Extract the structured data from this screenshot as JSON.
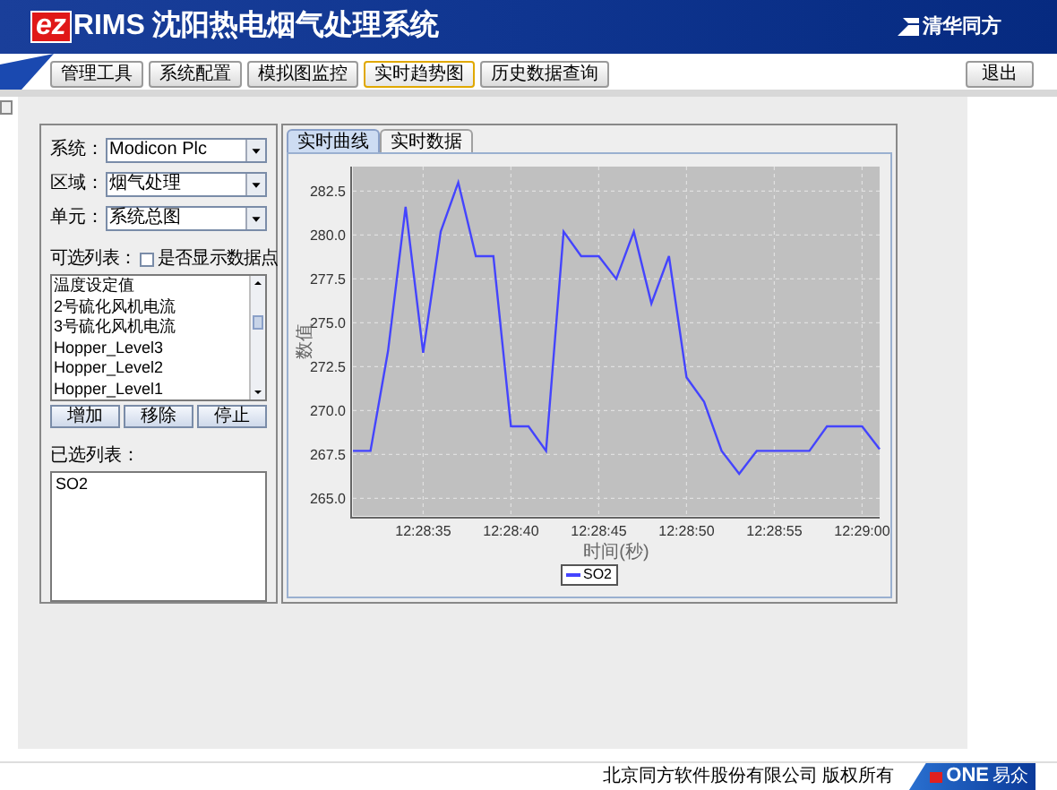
{
  "header": {
    "logo_ez": "ez",
    "logo_rims": "RIMS",
    "title": "沈阳热电烟气处理系统",
    "brand": "清华同方"
  },
  "nav": {
    "tabs": [
      {
        "label": "管理工具",
        "selected": false
      },
      {
        "label": "系统配置",
        "selected": false
      },
      {
        "label": "模拟图监控",
        "selected": false
      },
      {
        "label": "实时趋势图",
        "selected": true
      },
      {
        "label": "历史数据查询",
        "selected": false
      }
    ],
    "exit": "退出"
  },
  "filters": [
    {
      "label": "系统：",
      "value": "Modicon Plc"
    },
    {
      "label": "区域：",
      "value": "烟气处理"
    },
    {
      "label": "单元：",
      "value": "系统总图"
    }
  ],
  "available": {
    "label": "可选列表：",
    "show_points": {
      "label": "是否显示数据点",
      "checked": false
    },
    "items": [
      "温度设定值",
      "2号硫化风机电流",
      "3号硫化风机电流",
      "Hopper_Level3",
      "Hopper_Level2",
      "Hopper_Level1"
    ]
  },
  "buttons": [
    "增加",
    "移除",
    "停止"
  ],
  "selected_list": {
    "label": "已选列表：",
    "items": [
      "SO2"
    ]
  },
  "chart_tabs": [
    {
      "label": "实时曲线",
      "selected": true
    },
    {
      "label": "实时数据",
      "selected": false
    }
  ],
  "chart_data": {
    "type": "line",
    "xlabel": "时间(秒)",
    "ylabel": "数值",
    "categories": [
      null,
      null,
      null,
      null,
      "12:28:35",
      null,
      null,
      null,
      null,
      "12:28:40",
      null,
      null,
      null,
      null,
      "12:28:45",
      null,
      null,
      null,
      null,
      "12:28:50",
      null,
      null,
      null,
      null,
      "12:28:55",
      null,
      null,
      null,
      null,
      "12:29:00",
      null
    ],
    "series": [
      {
        "name": "SO2",
        "color": "#4444ff",
        "values": [
          267.7,
          267.7,
          273.4,
          281.6,
          273.3,
          280.2,
          283.0,
          278.8,
          278.8,
          269.1,
          269.1,
          267.7,
          280.2,
          278.8,
          278.8,
          277.5,
          280.2,
          276.1,
          278.8,
          271.9,
          270.5,
          267.7,
          266.4,
          267.7,
          267.7,
          267.7,
          267.7,
          269.1,
          269.1,
          269.1,
          267.8
        ]
      }
    ],
    "grid": true,
    "ylim": [
      264,
      283.9
    ],
    "yticks": [
      {
        "value": 265,
        "label": "265.0"
      },
      {
        "value": 267.5,
        "label": "267.5"
      },
      {
        "value": 270,
        "label": "270.0"
      },
      {
        "value": 272.5,
        "label": "272.5"
      },
      {
        "value": 275,
        "label": "275.0"
      },
      {
        "value": 277.5,
        "label": "277.5"
      },
      {
        "value": 280,
        "label": "280.0"
      },
      {
        "value": 282.5,
        "label": "282.5"
      }
    ]
  },
  "footer": {
    "copyright": "北京同方软件股份有限公司 版权所有",
    "logo": "ONE",
    "logo_sub": "易众"
  }
}
